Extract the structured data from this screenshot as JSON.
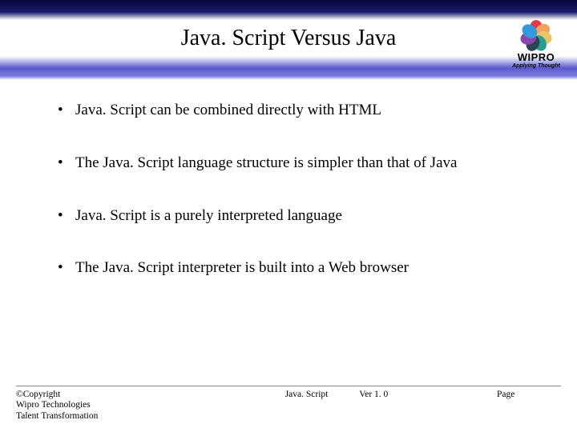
{
  "title": "Java. Script Versus Java",
  "logo": {
    "name": "WIPRO",
    "tagline": "Applying Thought"
  },
  "bullets": [
    "Java. Script can be combined directly with HTML",
    "The Java. Script language structure is simpler than that of Java",
    "Java. Script is a  purely interpreted language",
    "The Java. Script interpreter is built into a Web browser"
  ],
  "footer": {
    "copyright_lines": [
      "©Copyright",
      "Wipro Technologies",
      "Talent Transformation"
    ],
    "center_left": "Java. Script",
    "center_right": "Ver 1. 0",
    "right": "Page"
  }
}
